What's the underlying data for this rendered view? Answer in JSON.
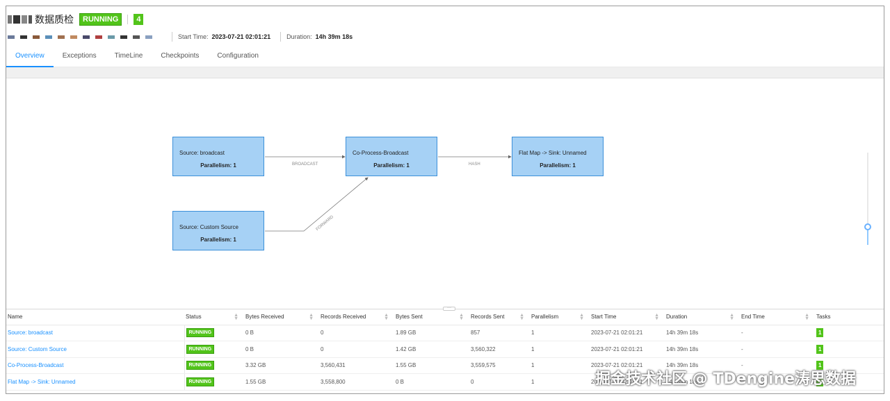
{
  "header": {
    "job_name": "数据质检",
    "status": "RUNNING",
    "task_count": "4",
    "start_time_label": "Start Time:",
    "start_time": "2023-07-21 02:01:21",
    "duration_label": "Duration:",
    "duration": "14h 39m 18s"
  },
  "tabs": [
    {
      "label": "Overview",
      "active": true
    },
    {
      "label": "Exceptions",
      "active": false
    },
    {
      "label": "TimeLine",
      "active": false
    },
    {
      "label": "Checkpoints",
      "active": false
    },
    {
      "label": "Configuration",
      "active": false
    }
  ],
  "graph": {
    "nodes": [
      {
        "name": "Source: broadcast",
        "parallelism": "Parallelism: 1"
      },
      {
        "name": "Co-Process-Broadcast",
        "parallelism": "Parallelism: 1"
      },
      {
        "name": "Flat Map -> Sink: Unnamed",
        "parallelism": "Parallelism: 1"
      },
      {
        "name": "Source: Custom Source",
        "parallelism": "Parallelism: 1"
      }
    ],
    "edges": [
      {
        "label": "BROADCAST"
      },
      {
        "label": "HASH"
      },
      {
        "label": "FORWARD"
      }
    ]
  },
  "table": {
    "columns": [
      "Name",
      "Status",
      "Bytes Received",
      "Records Received",
      "Bytes Sent",
      "Records Sent",
      "Parallelism",
      "Start Time",
      "Duration",
      "End Time",
      "Tasks"
    ],
    "rows": [
      {
        "name": "Source: broadcast",
        "status": "RUNNING",
        "bytes_received": "0 B",
        "records_received": "0",
        "bytes_sent": "1.89 GB",
        "records_sent": "857",
        "parallelism": "1",
        "start_time": "2023-07-21 02:01:21",
        "duration": "14h 39m 18s",
        "end_time": "-",
        "tasks": "1"
      },
      {
        "name": "Source: Custom Source",
        "status": "RUNNING",
        "bytes_received": "0 B",
        "records_received": "0",
        "bytes_sent": "1.42 GB",
        "records_sent": "3,560,322",
        "parallelism": "1",
        "start_time": "2023-07-21 02:01:21",
        "duration": "14h 39m 18s",
        "end_time": "-",
        "tasks": "1"
      },
      {
        "name": "Co-Process-Broadcast",
        "status": "RUNNING",
        "bytes_received": "3.32 GB",
        "records_received": "3,560,431",
        "bytes_sent": "1.55 GB",
        "records_sent": "3,559,575",
        "parallelism": "1",
        "start_time": "2023-07-21 02:01:21",
        "duration": "14h 39m 18s",
        "end_time": "-",
        "tasks": "1"
      },
      {
        "name": "Flat Map -> Sink: Unnamed",
        "status": "RUNNING",
        "bytes_received": "1.55 GB",
        "records_received": "3,558,800",
        "bytes_sent": "0 B",
        "records_sent": "0",
        "parallelism": "1",
        "start_time": "2023-07-21 02:01:21",
        "duration": "14h 39m 18s",
        "end_time": "-",
        "tasks": "1"
      }
    ]
  },
  "watermark": "掘金技术社区 @ TDengine涛思数据",
  "colors": {
    "accent": "#1890ff",
    "running": "#52c41a",
    "node_fill": "#a6d1f5",
    "node_border": "#3b8fd9"
  },
  "icons": {
    "sort": "sort-icon",
    "zoom": "zoom-slider",
    "splitter": "drag-handle-icon"
  }
}
